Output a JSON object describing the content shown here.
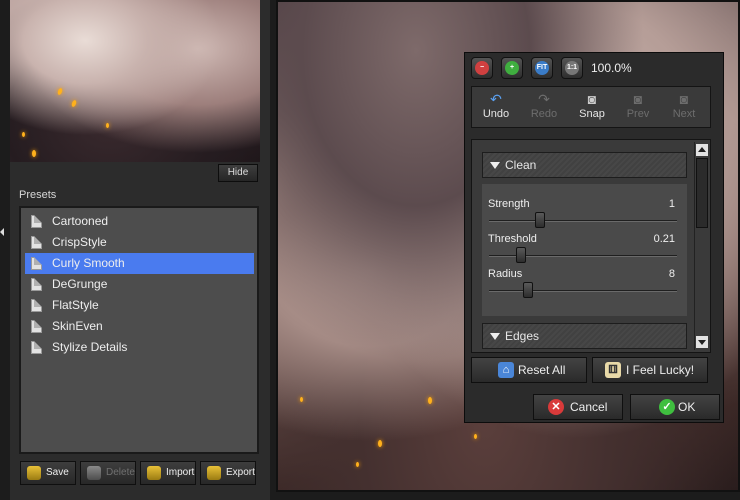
{
  "left_panel": {
    "hide_label": "Hide",
    "presets_title": "Presets",
    "presets": [
      {
        "label": "Cartooned",
        "selected": false
      },
      {
        "label": "CrispStyle",
        "selected": false
      },
      {
        "label": "Curly Smooth",
        "selected": true
      },
      {
        "label": "DeGrunge",
        "selected": false
      },
      {
        "label": "FlatStyle",
        "selected": false
      },
      {
        "label": "SkinEven",
        "selected": false
      },
      {
        "label": "Stylize Details",
        "selected": false
      }
    ],
    "toolbar": {
      "save": "Save",
      "delete": "Delete",
      "import": "Import",
      "export": "Export"
    }
  },
  "dialog": {
    "zoom": {
      "zoom_out_icon": "zoom-out-icon",
      "zoom_in_icon": "zoom-in-icon",
      "fit_label": "FIT",
      "actual_label": "1:1",
      "level": "100.0%"
    },
    "toolbar": {
      "undo": "Undo",
      "redo": "Redo",
      "snap": "Snap",
      "prev": "Prev",
      "next": "Next"
    },
    "sections": {
      "clean_title": "Clean",
      "edges_title": "Edges"
    },
    "sliders": [
      {
        "label": "Strength",
        "value": "1",
        "position": 0.27
      },
      {
        "label": "Threshold",
        "value": "0.21",
        "position": 0.17
      },
      {
        "label": "Radius",
        "value": "8",
        "position": 0.21
      }
    ],
    "buttons": {
      "reset_all": "Reset All",
      "feel_lucky": "I Feel Lucky!",
      "cancel": "Cancel",
      "ok": "OK"
    }
  },
  "colors": {
    "selection": "#4a7bef",
    "ok_icon": "#3fbf3f",
    "cancel_icon": "#d93a3a"
  }
}
